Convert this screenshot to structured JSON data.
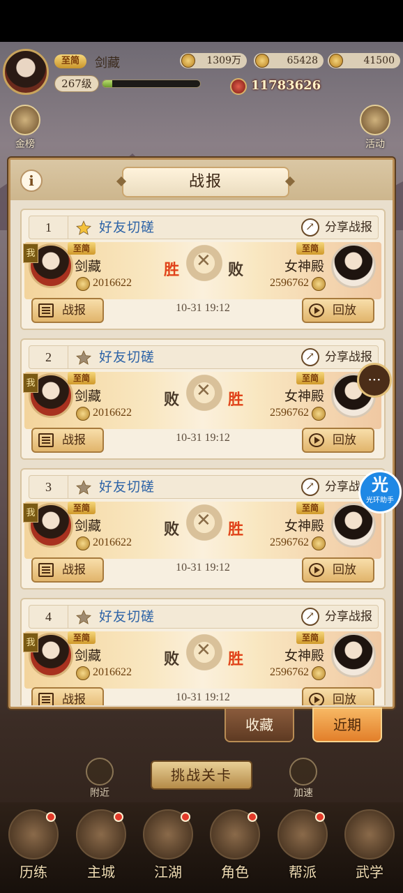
{
  "header": {
    "vip": "至简",
    "player_name": "剑藏",
    "level": "267级",
    "exp_fraction": 0.1,
    "coins": "1309万",
    "ingots": "65428",
    "gold": "41500",
    "power": "11783626"
  },
  "side": {
    "left_label": "金榜",
    "right_label": "活动"
  },
  "panel": {
    "title": "战报",
    "info_icon": "i",
    "battles": [
      {
        "rank": "1",
        "starred": true,
        "type": "好友切磋",
        "share": "分享战报",
        "me": {
          "tag": "我",
          "vip": "至简",
          "name": "剑藏",
          "power": "2016622"
        },
        "left_result": "胜",
        "right_result": "败",
        "enemy": {
          "vip": "至简",
          "name": "女神殿",
          "power": "2596762"
        },
        "time": "10-31 19:12",
        "report_btn": "战报",
        "replay_btn": "回放"
      },
      {
        "rank": "2",
        "starred": false,
        "type": "好友切磋",
        "share": "分享战报",
        "me": {
          "tag": "我",
          "vip": "至简",
          "name": "剑藏",
          "power": "2016622"
        },
        "left_result": "败",
        "right_result": "胜",
        "enemy": {
          "vip": "至简",
          "name": "女神殿",
          "power": "2596762"
        },
        "time": "10-31 19:12",
        "report_btn": "战报",
        "replay_btn": "回放"
      },
      {
        "rank": "3",
        "starred": false,
        "type": "好友切磋",
        "share": "分享战报",
        "me": {
          "tag": "我",
          "vip": "至简",
          "name": "剑藏",
          "power": "2016622"
        },
        "left_result": "败",
        "right_result": "胜",
        "enemy": {
          "vip": "至简",
          "name": "女神殿",
          "power": "2596762"
        },
        "time": "10-31 19:12",
        "report_btn": "战报",
        "replay_btn": "回放"
      },
      {
        "rank": "4",
        "starred": false,
        "type": "好友切磋",
        "share": "分享战报",
        "me": {
          "tag": "我",
          "vip": "至简",
          "name": "剑藏",
          "power": "2016622"
        },
        "left_result": "败",
        "right_result": "胜",
        "enemy": {
          "vip": "至简",
          "name": "女神殿",
          "power": "2596762"
        },
        "time": "10-31 19:12",
        "report_btn": "战报",
        "replay_btn": "回放"
      }
    ]
  },
  "tabs": {
    "favorites": "收藏",
    "recent": "近期"
  },
  "lower": {
    "nearby": "附近",
    "challenge": "挑战关卡",
    "speedup": "加速"
  },
  "nav": [
    {
      "label": "历练",
      "dot": true
    },
    {
      "label": "主城",
      "dot": true
    },
    {
      "label": "江湖",
      "dot": true
    },
    {
      "label": "角色",
      "dot": true
    },
    {
      "label": "帮派",
      "dot": true
    },
    {
      "label": "武学",
      "dot": false
    }
  ],
  "floating": {
    "chat": "···",
    "helper_big": "光",
    "helper_small": "光环助手"
  },
  "colors": {
    "win": "#e0421d",
    "lose": "#4a3a2a",
    "link_blue": "#2c62a6",
    "tab_active": "#e27f2a"
  }
}
